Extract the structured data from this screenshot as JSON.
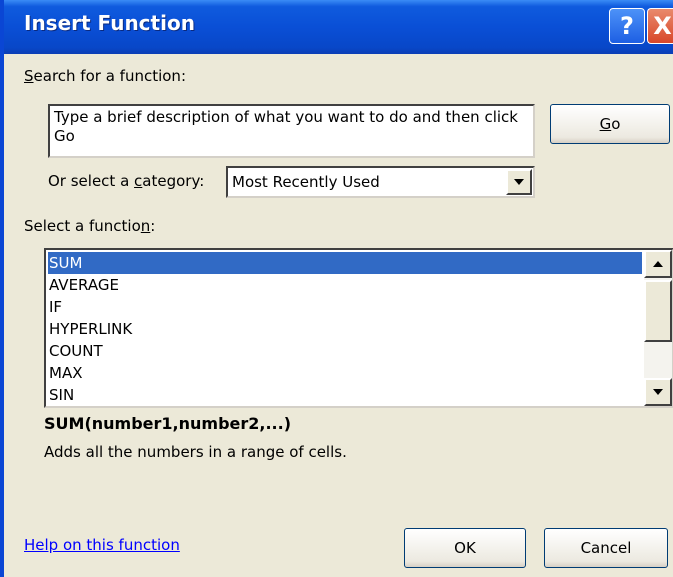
{
  "window": {
    "title": "Insert Function",
    "help_glyph": "?",
    "close_glyph": "X"
  },
  "search": {
    "label_pre": "",
    "label_key": "S",
    "label_post": "earch for a function:",
    "value": "Type a brief description of what you want to do and then click Go",
    "go_pre": "",
    "go_key": "G",
    "go_post": "o"
  },
  "category": {
    "label_pre": "Or select a ",
    "label_key": "c",
    "label_post": "ategory:",
    "value": "Most Recently Used"
  },
  "functions": {
    "label_pre": "Select a functio",
    "label_key": "n",
    "label_post": ":",
    "items": [
      "SUM",
      "AVERAGE",
      "IF",
      "HYPERLINK",
      "COUNT",
      "MAX",
      "SIN"
    ],
    "selected_index": 0
  },
  "details": {
    "signature": "SUM(number1,number2,...)",
    "description": "Adds all the numbers in a range of cells."
  },
  "footer": {
    "help_link": "Help on this function",
    "ok_label": "OK",
    "cancel_label": "Cancel"
  },
  "colors": {
    "selection": "#316ac5",
    "link": "#0000ff",
    "titlebar": "#0a4fd6"
  }
}
